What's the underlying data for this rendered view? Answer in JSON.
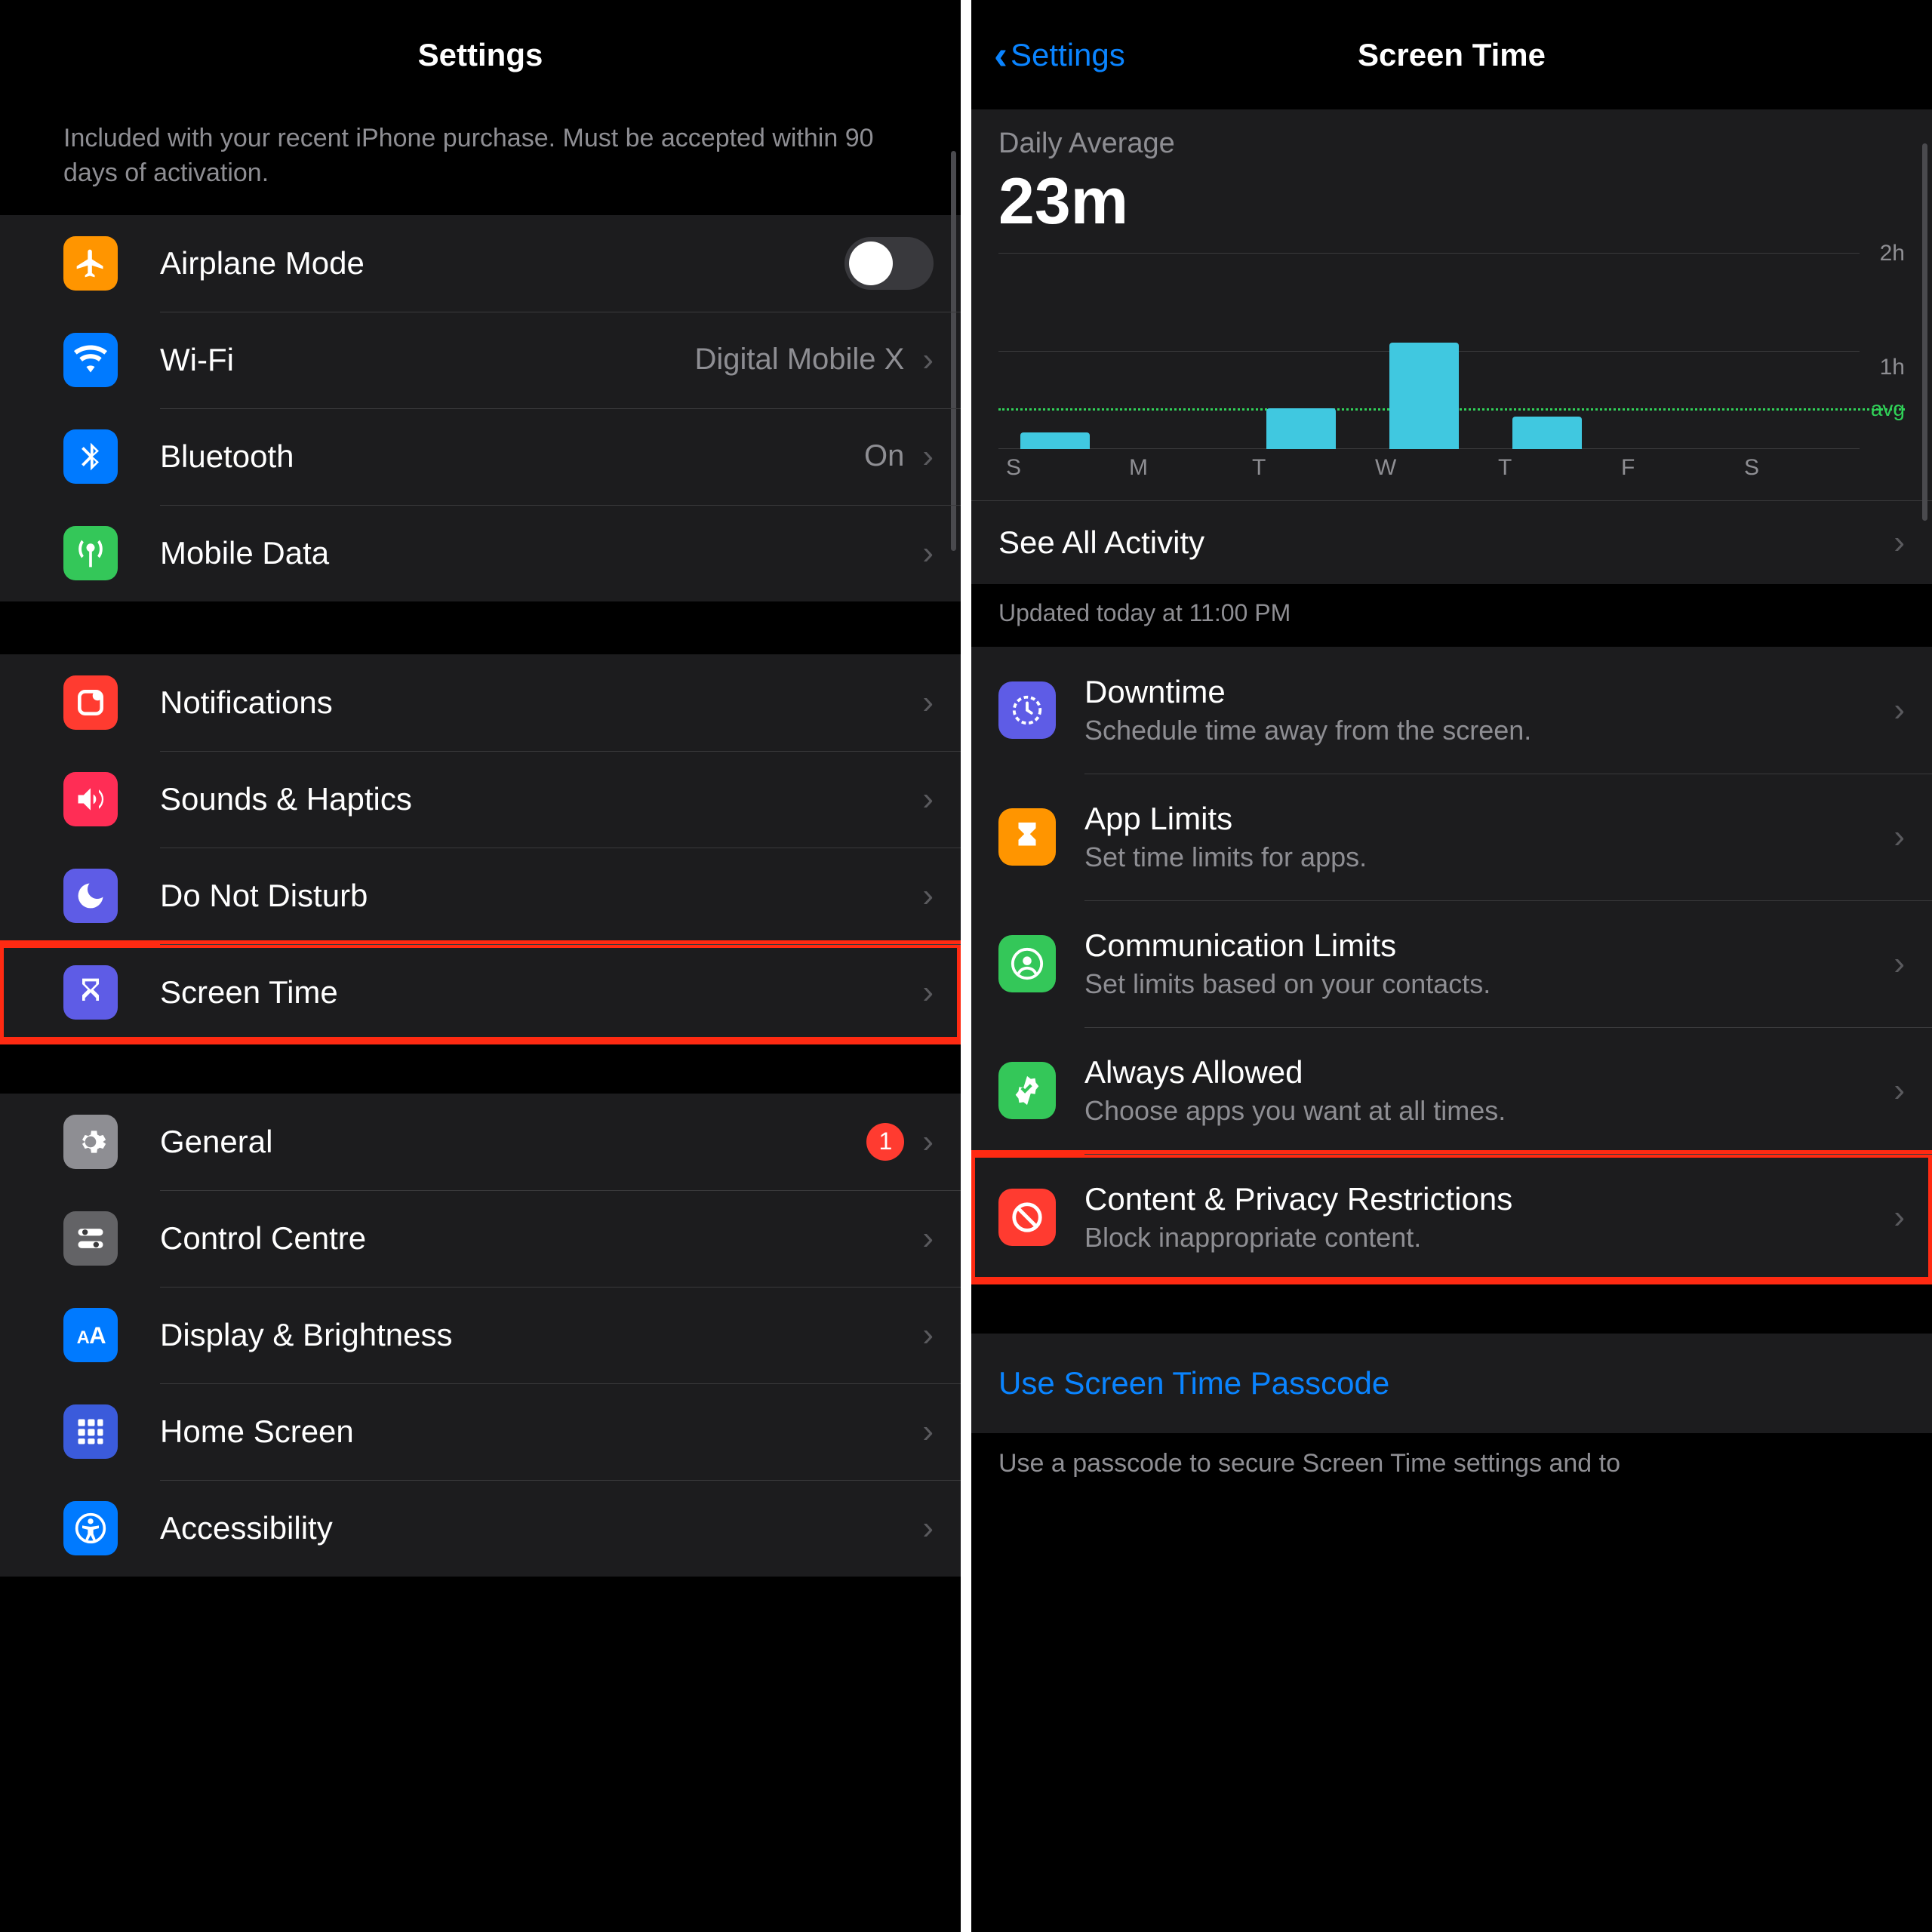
{
  "left": {
    "title": "Settings",
    "promo_note": "Included with your recent iPhone purchase. Must be accepted within 90 days of activation.",
    "rows": {
      "airplane": "Airplane Mode",
      "wifi": "Wi-Fi",
      "wifi_value": "Digital Mobile X",
      "bluetooth": "Bluetooth",
      "bluetooth_value": "On",
      "mobile_data": "Mobile Data",
      "notifications": "Notifications",
      "sounds": "Sounds & Haptics",
      "dnd": "Do Not Disturb",
      "screen_time": "Screen Time",
      "general": "General",
      "general_badge": "1",
      "control_centre": "Control Centre",
      "display": "Display & Brightness",
      "home_screen": "Home Screen",
      "accessibility": "Accessibility"
    }
  },
  "right": {
    "back": "Settings",
    "title": "Screen Time",
    "summary_label": "Daily Average",
    "summary_value": "23m",
    "y2h": "2h",
    "y1h": "1h",
    "avg_label": "avg",
    "days": [
      "S",
      "M",
      "T",
      "W",
      "T",
      "F",
      "S"
    ],
    "see_all": "See All Activity",
    "updated": "Updated today at 11:00 PM",
    "items": {
      "downtime": {
        "title": "Downtime",
        "sub": "Schedule time away from the screen."
      },
      "app_limits": {
        "title": "App Limits",
        "sub": "Set time limits for apps."
      },
      "comm_limits": {
        "title": "Communication Limits",
        "sub": "Set limits based on your contacts."
      },
      "always_allowed": {
        "title": "Always Allowed",
        "sub": "Choose apps you want at all times."
      },
      "content_privacy": {
        "title": "Content & Privacy Restrictions",
        "sub": "Block inappropriate content."
      }
    },
    "passcode_link": "Use Screen Time Passcode",
    "passcode_note": "Use a passcode to secure Screen Time settings and to"
  },
  "chart_data": {
    "type": "bar",
    "title": "Daily Average Screen Time",
    "categories": [
      "S",
      "M",
      "T",
      "W",
      "T",
      "F",
      "S"
    ],
    "values_minutes": [
      10,
      0,
      25,
      65,
      20,
      0,
      0
    ],
    "avg_minutes": 23,
    "ylabel": "hours",
    "ylim": [
      0,
      120
    ],
    "gridlines_minutes": [
      60,
      120
    ]
  }
}
